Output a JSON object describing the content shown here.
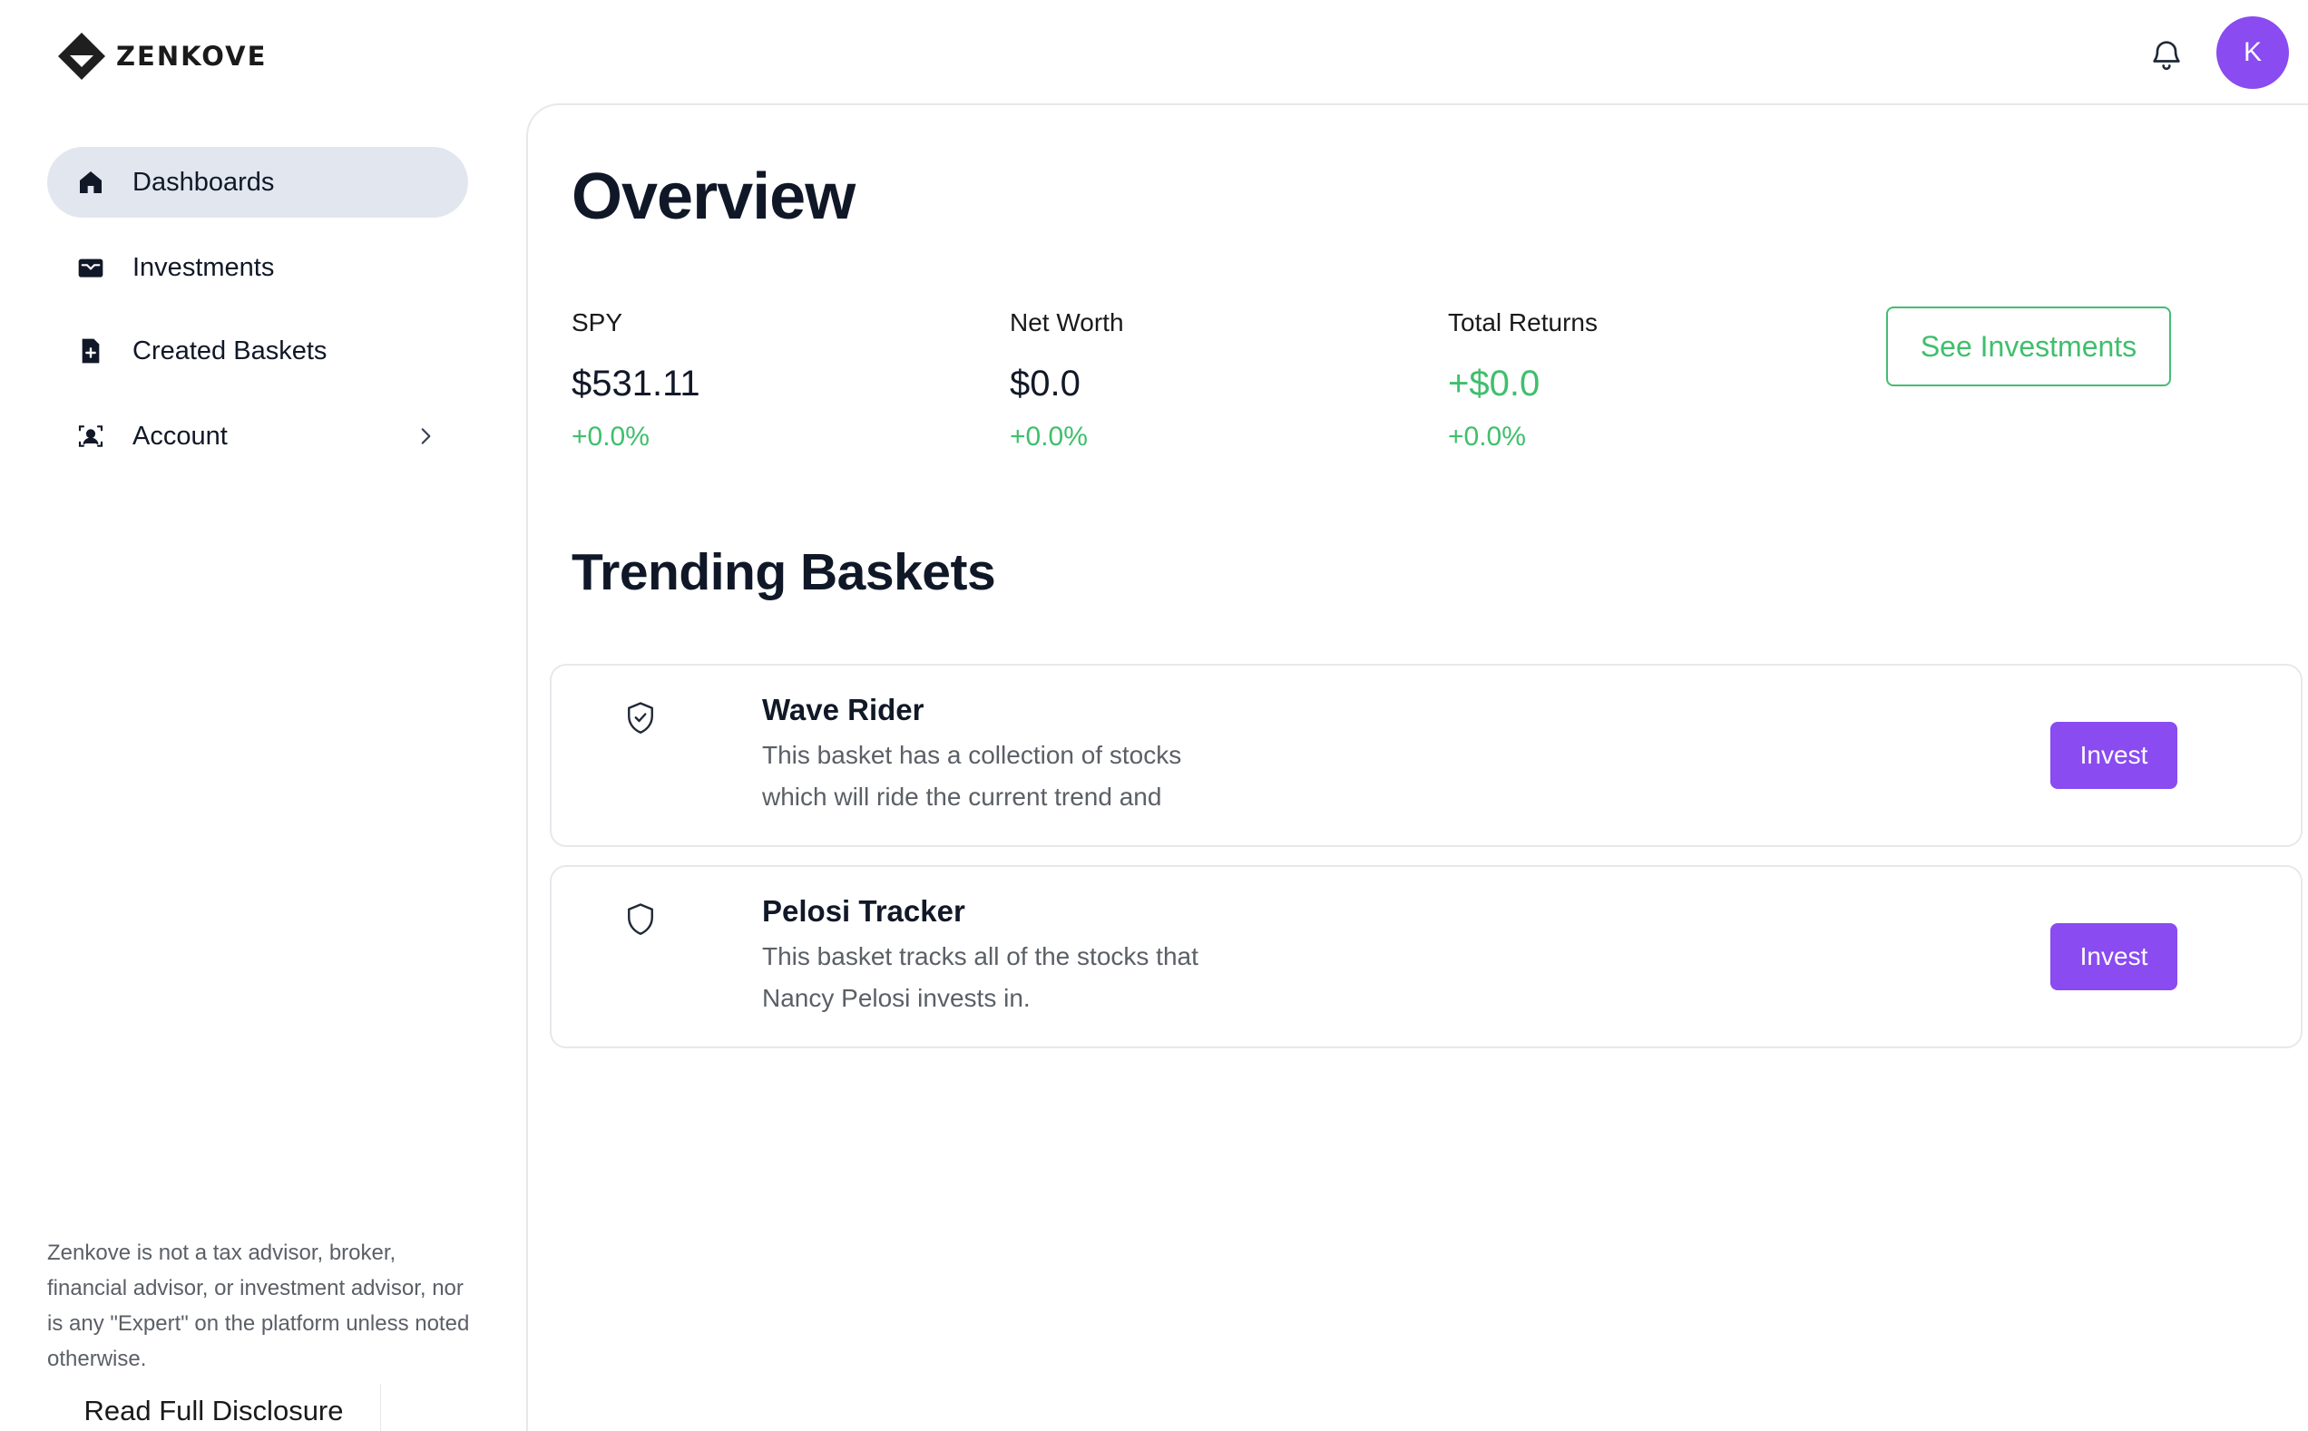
{
  "brand": {
    "name": "ZENKOVE"
  },
  "header": {
    "avatar_initial": "K",
    "icons": {
      "notifications": "bell-icon"
    }
  },
  "sidebar": {
    "items": [
      {
        "label": "Dashboards",
        "icon": "home-icon",
        "active": true
      },
      {
        "label": "Investments",
        "icon": "wallet-icon",
        "active": false
      },
      {
        "label": "Created Baskets",
        "icon": "file-plus-icon",
        "active": false
      },
      {
        "label": "Account",
        "icon": "user-card-icon",
        "active": false,
        "has_submenu": true
      }
    ],
    "disclaimer": "Zenkove is not a tax advisor, broker, financial advisor, or investment advisor, nor is any \"Expert\" on the platform unless noted otherwise.",
    "disclosure_label": "Read Full Disclosure"
  },
  "main": {
    "title": "Overview",
    "stats": [
      {
        "label": "SPY",
        "value": "$531.11",
        "change": "+0.0%"
      },
      {
        "label": "Net Worth",
        "value": "$0.0",
        "change": "+0.0%"
      },
      {
        "label": "Total Returns",
        "value": "+$0.0",
        "change": "+0.0%"
      }
    ],
    "see_investments_label": "See Investments",
    "trending_title": "Trending Baskets",
    "baskets": [
      {
        "title": "Wave Rider",
        "desc_line1": "This basket has a collection of stocks",
        "desc_line2": "which will ride the current trend and",
        "icon": "shield-check-icon",
        "action_label": "Invest"
      },
      {
        "title": "Pelosi Tracker",
        "desc_line1": "This basket tracks all of the stocks that",
        "desc_line2": "Nancy Pelosi invests in.",
        "icon": "shield-icon",
        "action_label": "Invest"
      }
    ]
  },
  "colors": {
    "accent_purple": "#8a4bf0",
    "positive_green": "#3fbf6c",
    "active_nav_bg": "#e2e7ef",
    "heading": "#101828"
  }
}
